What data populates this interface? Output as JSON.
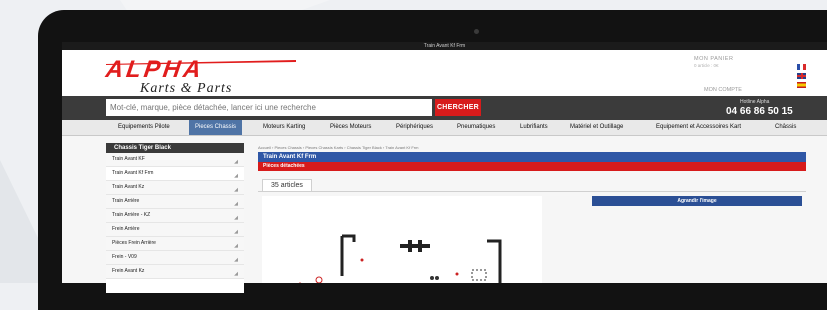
{
  "window": {
    "title": "Train Avant Kf Frm"
  },
  "header": {
    "logo_main": "ALPHA",
    "logo_sub": "Karts & Parts",
    "cart_title": "MON PANIER",
    "cart_sub": "0 article : 0€",
    "account": "MON COMPTE",
    "flags": [
      "fr-flag",
      "uk-flag",
      "es-flag"
    ]
  },
  "search": {
    "placeholder": "Mot-clé, marque, pièce détachée, lancer ici une recherche",
    "button": "CHERCHER",
    "hotline_label": "Hotline Alpha",
    "hotline_number": "04 66 86 50 15"
  },
  "nav": {
    "items": [
      {
        "label": "Equipements Pilote"
      },
      {
        "label": "Pieces Chassis",
        "active": true
      },
      {
        "label": "Moteurs Karting"
      },
      {
        "label": "Pièces Moteurs"
      },
      {
        "label": "Périphériques"
      },
      {
        "label": "Pneumatiques"
      },
      {
        "label": "Lubrifiants"
      },
      {
        "label": "Matériel et Outillage"
      },
      {
        "label": "Equipement et Accessoires Kart"
      },
      {
        "label": "Châssis"
      }
    ]
  },
  "sidebar": {
    "title": "Chassis Tiger Black",
    "items": [
      {
        "label": "Train Avant KF"
      },
      {
        "label": "Train Avant Kf Frm",
        "active": true
      },
      {
        "label": "Train Avant Kz"
      },
      {
        "label": "Train Arrière"
      },
      {
        "label": "Train Arrière - KZ"
      },
      {
        "label": "Frein Arrière"
      },
      {
        "label": "Pièces Frein Arrière"
      },
      {
        "label": "Frein - V09"
      },
      {
        "label": "Frein Avant Kz"
      }
    ]
  },
  "main": {
    "breadcrumb": "Accueil › Pieces Chassis › Pieces Chassis Karts › Chassis Tiger Black › Train Avant Kf Frm",
    "title": "Train Avant Kf Frm",
    "section": "Pièces détachées",
    "count": "35 articles",
    "enlarge": "Agrandir l'image"
  },
  "colors": {
    "brand_red": "#d71b1b",
    "nav_active": "#4f74a6",
    "panel_blue": "#2f57a6"
  }
}
